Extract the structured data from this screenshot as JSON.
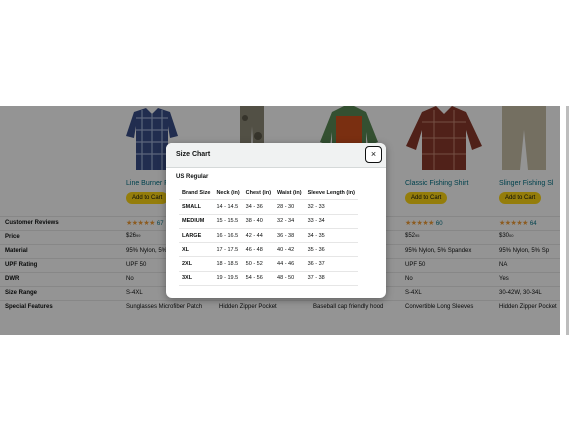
{
  "products": [
    {
      "name": "Line Burner Fi",
      "reviews_count": "67",
      "price_whole": "$26",
      "price_frac": "99",
      "material": "95% Nylon, 5% Sp",
      "upf": "UPF 50",
      "dwr": "No",
      "size_range": "S-4XL",
      "features": "Sunglasses Microfiber Patch",
      "cart": "Add to Cart"
    },
    {
      "name": "",
      "reviews_count": "",
      "price_whole": "",
      "price_frac": "",
      "material": "",
      "upf": "",
      "dwr": "",
      "size_range": "",
      "features": "Hidden Zipper Pocket",
      "cart": ""
    },
    {
      "name": "",
      "reviews_count": "",
      "price_whole": "",
      "price_frac": "",
      "material": "",
      "upf": "",
      "dwr": "",
      "size_range": "",
      "features": "Baseball cap friendly hood",
      "cart": ""
    },
    {
      "name": "Classic Fishing Shirt",
      "reviews_count": "60",
      "price_whole": "$52",
      "price_frac": "95",
      "material": "95% Nylon, 5% Spandex",
      "upf": "UPF 50",
      "dwr": "No",
      "size_range": "S-4XL",
      "features": "Convertible Long Sleeves",
      "cart": "Add to Cart"
    },
    {
      "name": "Slinger Fishing Sl",
      "reviews_count": "64",
      "price_whole": "$30",
      "price_frac": "00",
      "material": "95% Nylon, 5% Sp",
      "upf": "NA",
      "dwr": "Yes",
      "size_range": "30-42W, 30-34L",
      "features": "Hidden Zipper Pocket",
      "cart": "Add to Cart"
    }
  ],
  "row_labels": {
    "reviews": "Customer Reviews",
    "price": "Price",
    "material": "Material",
    "upf": "UPF Rating",
    "dwr": "DWR",
    "size_range": "Size Range",
    "features": "Special Features"
  },
  "stars": "★★★★★",
  "modal": {
    "title": "Size Chart",
    "close_icon": "×",
    "region": "US Regular",
    "headers": [
      "Brand Size",
      "Neck (in)",
      "Chest (in)",
      "Waist (in)",
      "Sleeve Length (in)"
    ],
    "rows": [
      [
        "SMALL",
        "14 - 14.5",
        "34 - 36",
        "28 - 30",
        "32 - 33"
      ],
      [
        "MEDIUM",
        "15 - 15.5",
        "38 - 40",
        "32 - 34",
        "33 - 34"
      ],
      [
        "LARGE",
        "16 - 16.5",
        "42 - 44",
        "36 - 38",
        "34 - 35"
      ],
      [
        "XL",
        "17 - 17.5",
        "46 - 48",
        "40 - 42",
        "35 - 36"
      ],
      [
        "2XL",
        "18 - 18.5",
        "50 - 52",
        "44 - 46",
        "36 - 37"
      ],
      [
        "3XL",
        "19 - 19.5",
        "54 - 56",
        "48 - 50",
        "37 - 38"
      ]
    ]
  }
}
